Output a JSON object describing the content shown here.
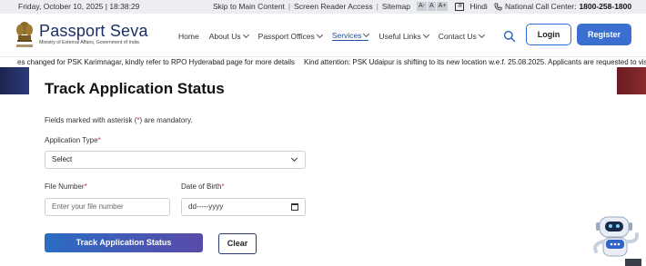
{
  "topbar": {
    "datetime": "Friday, October 10, 2025 | 18:38:29",
    "skip_link": "Skip to Main Content",
    "screen_reader": "Screen Reader Access",
    "sitemap": "Sitemap",
    "font_small": "A-",
    "font_normal": "A",
    "font_large": "A+",
    "hindi": "Hindi",
    "call_label": "National Call Center:",
    "call_number": "1800-258-1800"
  },
  "header": {
    "brand_name": "Passport Seva",
    "brand_sub": "Ministry of External Affairs, Government of India",
    "emblem_text": "सत्यमेव जयते",
    "nav": [
      {
        "label": "Home"
      },
      {
        "label": "About Us"
      },
      {
        "label": "Passport Offices"
      },
      {
        "label": "Services"
      },
      {
        "label": "Useful Links"
      },
      {
        "label": "Contact Us"
      }
    ],
    "login": "Login",
    "register": "Register"
  },
  "ticker": {
    "msg1": "es changed for PSK Karimnagar, kindly refer to RPO Hyderabad page for more details",
    "msg2": "Kind attention: PSK Udaipur is shifting to its new location w.e.f. 25.08.2025. Applicants are requested to visi"
  },
  "form": {
    "title": "Track Application Status",
    "mandatory_note_pre": "Fields marked with asterisk (",
    "mandatory_note_star": "*",
    "mandatory_note_post": ") are mandatory.",
    "app_type_label": "Application Type",
    "app_type_value": "Select",
    "file_number_label": "File Number",
    "file_number_placeholder": "Enter your file number",
    "dob_label": "Date of Birth",
    "dob_value": "dd-----yyyy",
    "required_mark": "*",
    "track_button": "Track Application Status",
    "clear_button": "Clear"
  },
  "colors": {
    "brand": "#1a2f66",
    "primary": "#3a6fd0",
    "required": "#dd3333"
  }
}
